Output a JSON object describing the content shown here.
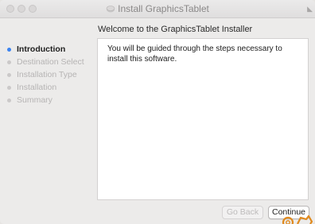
{
  "window": {
    "title": "Install GraphicsTablet",
    "title_icon": "installer-box-icon"
  },
  "header": {
    "heading": "Welcome to the GraphicsTablet Installer"
  },
  "sidebar": {
    "steps": [
      {
        "label": "Introduction",
        "active": true
      },
      {
        "label": "Destination Select",
        "active": false
      },
      {
        "label": "Installation Type",
        "active": false
      },
      {
        "label": "Installation",
        "active": false
      },
      {
        "label": "Summary",
        "active": false
      }
    ]
  },
  "main": {
    "body_text": "You will be guided through the steps necessary to install this software."
  },
  "footer": {
    "go_back_label": "Go Back",
    "continue_label": "Continue"
  },
  "colors": {
    "active_step_dot": "#3b83f0",
    "cursor": "#e08a1e"
  }
}
